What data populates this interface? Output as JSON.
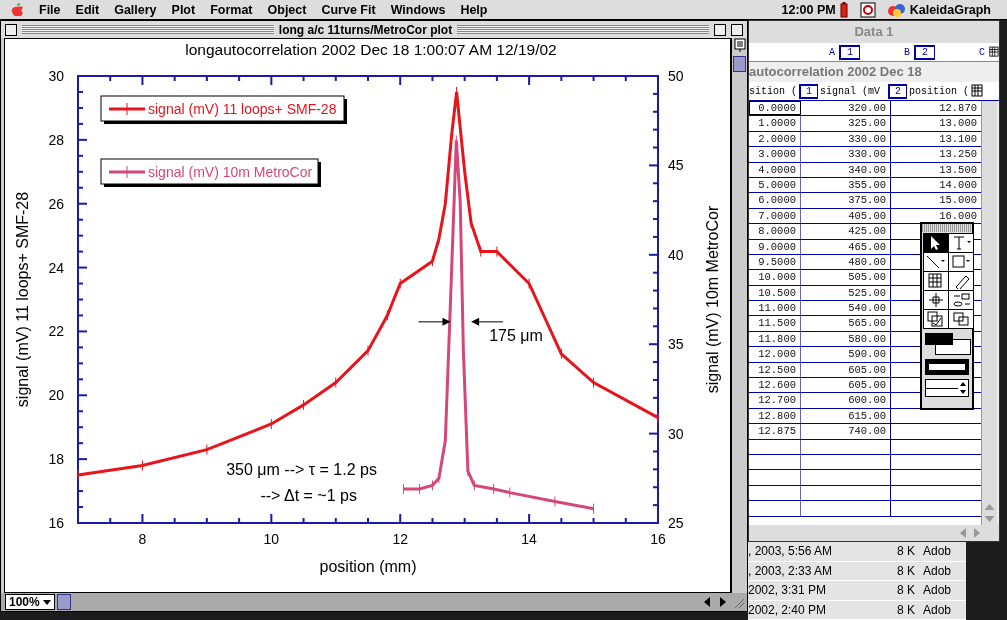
{
  "menubar": {
    "items": [
      "File",
      "Edit",
      "Gallery",
      "Plot",
      "Format",
      "Object",
      "Curve Fit",
      "Windows",
      "Help"
    ],
    "clock": "12:00 PM",
    "app": "KaleidaGraph"
  },
  "plot_window": {
    "title": "long a/c 11turns/MetroCor plot",
    "zoom": "100%",
    "chart_data": {
      "type": "line",
      "title": "longautocorrelation 2002 Dec 18 1:00:07 AM 12/19/02",
      "xlabel": "position (mm)",
      "ylabel": "signal (mV) 11 loops+ SMF-28",
      "y2label": "signal (mV) 10m MetroCor",
      "xlim": [
        7,
        16
      ],
      "ylim": [
        16,
        30
      ],
      "y2lim": [
        25,
        50
      ],
      "xticks": [
        8,
        10,
        12,
        14,
        16
      ],
      "yticks": [
        16,
        18,
        20,
        22,
        24,
        26,
        28,
        30
      ],
      "y2ticks": [
        25,
        30,
        35,
        40,
        45,
        50
      ],
      "series": [
        {
          "name": "signal (mV) 11 loops+ SMF-28",
          "color": "#e8141c",
          "x": [
            7,
            8,
            9,
            10,
            10.5,
            11,
            11.5,
            11.8,
            12,
            12.5,
            12.6,
            12.7,
            12.8,
            12.875,
            13,
            13.1,
            13.25,
            13.5,
            14,
            14.5,
            15,
            16
          ],
          "values": [
            17.5,
            17.8,
            18.3,
            19.1,
            19.7,
            20.4,
            21.4,
            22.5,
            23.5,
            24.2,
            24.9,
            26,
            28.2,
            29.5,
            27,
            25.4,
            24.5,
            24.5,
            23.5,
            21.3,
            20.4,
            19.3
          ]
        },
        {
          "name": "signal (mV) 10m MetroCor",
          "color": "#d4477a",
          "axis": "y2",
          "x": [
            12.05,
            12.3,
            12.5,
            12.6,
            12.7,
            12.78,
            12.87,
            12.93,
            12.98,
            13.05,
            13.15,
            13.45,
            13.7,
            14.4,
            15
          ],
          "values": [
            26.9,
            26.9,
            27.1,
            27.5,
            29.6,
            37.4,
            46.4,
            43,
            34.6,
            27.9,
            27.1,
            26.9,
            26.7,
            26.2,
            25.8
          ]
        }
      ],
      "legend": "upper left",
      "annotations": [
        "175 μm",
        "350 μm --> τ = 1.2 ps",
        "--> Δt = ~1 ps"
      ]
    }
  },
  "data_window": {
    "title": "Data 1",
    "columns": [
      {
        "letter": "A",
        "number": "1"
      },
      {
        "letter": "B",
        "number": "2"
      },
      {
        "letter": "C"
      }
    ],
    "sheet": {
      "title": "autocorrelation 2002 Dec 18",
      "headers": [
        {
          "label": "sition ("
        },
        {
          "label": "signal (mV",
          "number": "1"
        },
        {
          "label": "position (",
          "number": "2"
        }
      ],
      "rows": [
        {
          "c1": "0.0000",
          "c2": "320.00",
          "c3": "12.870",
          "selected": true
        },
        {
          "c1": "1.0000",
          "c2": "325.00",
          "c3": "13.000",
          "selected": false
        },
        {
          "c1": "2.0000",
          "c2": "330.00",
          "c3": "13.100",
          "selected": false
        },
        {
          "c1": "3.0000",
          "c2": "330.00",
          "c3": "13.250",
          "selected": false
        },
        {
          "c1": "4.0000",
          "c2": "340.00",
          "c3": "13.500",
          "selected": false
        },
        {
          "c1": "5.0000",
          "c2": "355.00",
          "c3": "14.000",
          "selected": false
        },
        {
          "c1": "6.0000",
          "c2": "375.00",
          "c3": "15.000",
          "selected": false
        },
        {
          "c1": "7.0000",
          "c2": "405.00",
          "c3": "16.000",
          "selected": false
        },
        {
          "c1": "8.0000",
          "c2": "425.00",
          "selected": false
        },
        {
          "c1": "9.0000",
          "c2": "465.00",
          "selected": false
        },
        {
          "c1": "9.5000",
          "c2": "480.00",
          "selected": false
        },
        {
          "c1": "10.000",
          "c2": "505.00",
          "selected": false
        },
        {
          "c1": "10.500",
          "c2": "525.00",
          "selected": false
        },
        {
          "c1": "11.000",
          "c2": "540.00",
          "selected": false
        },
        {
          "c1": "11.500",
          "c2": "565.00",
          "selected": false
        },
        {
          "c1": "11.800",
          "c2": "580.00",
          "selected": false
        },
        {
          "c1": "12.000",
          "c2": "590.00",
          "selected": false
        },
        {
          "c1": "12.500",
          "c2": "605.00",
          "selected": false
        },
        {
          "c1": "12.600",
          "c2": "605.00",
          "selected": false
        },
        {
          "c1": "12.700",
          "c2": "600.00",
          "selected": false
        },
        {
          "c1": "12.800",
          "c2": "615.00",
          "selected": false
        },
        {
          "c1": "12.875",
          "c2": "740.00",
          "selected": false
        }
      ]
    }
  },
  "tool_palette": {
    "tools": [
      {
        "kind": "arrow",
        "selected": true
      },
      {
        "kind": "text",
        "selected": false
      },
      {
        "kind": "line",
        "selected": false
      },
      {
        "kind": "rect",
        "selected": false
      },
      {
        "kind": "table",
        "selected": false
      },
      {
        "kind": "eraser",
        "selected": false
      },
      {
        "kind": "crosshair",
        "selected": false
      },
      {
        "kind": "swap",
        "selected": false
      },
      {
        "kind": "graph",
        "selected": false
      },
      {
        "kind": "layers",
        "selected": false
      }
    ]
  },
  "file_list": [
    {
      "date": ", 2003, 5:56 AM",
      "size": "8 K",
      "kind": "Adob"
    },
    {
      "date": ", 2003, 2:33 AM",
      "size": "8 K",
      "kind": "Adob"
    },
    {
      "date": "2002, 3:31 PM",
      "size": "8 K",
      "kind": "Adob"
    },
    {
      "date": "2002, 2:40 PM",
      "size": "8 K",
      "kind": "Adob"
    }
  ]
}
